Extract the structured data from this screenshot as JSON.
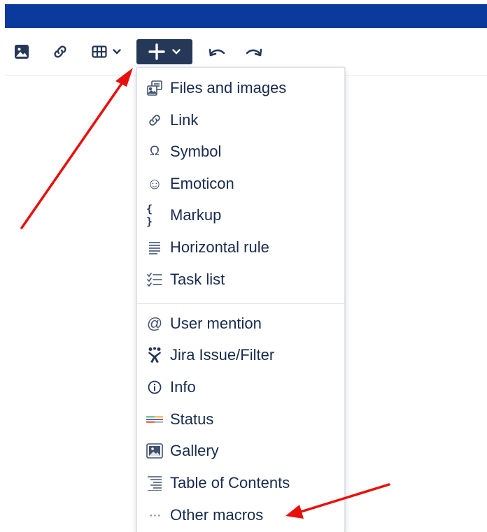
{
  "colors": {
    "topbar": "#0a3a9c",
    "toolbar_icon": "#253858",
    "arrow": "#e8100b",
    "insert_bg": "#253858"
  },
  "toolbar": {
    "buttons": [
      {
        "icon": "image-icon"
      },
      {
        "icon": "link-icon"
      },
      {
        "icon": "table-icon",
        "dropdown": true
      },
      {
        "icon": "plus-icon",
        "dropdown": true,
        "active": true
      },
      {
        "icon": "undo-icon"
      },
      {
        "icon": "redo-icon"
      }
    ]
  },
  "insert_menu": {
    "section1": [
      {
        "label": "Files and images",
        "icon": "files-images-icon"
      },
      {
        "label": "Link",
        "icon": "link-icon"
      },
      {
        "label": "Symbol",
        "icon": "omega-icon",
        "glyph": "Ω"
      },
      {
        "label": "Emoticon",
        "icon": "smiley-icon",
        "glyph": "☺"
      },
      {
        "label": "Markup",
        "icon": "braces-icon",
        "glyph": "{ }"
      },
      {
        "label": "Horizontal rule",
        "icon": "horizontal-rule-icon"
      },
      {
        "label": "Task list",
        "icon": "task-list-icon"
      }
    ],
    "section2": [
      {
        "label": "User mention",
        "icon": "at-icon",
        "glyph": "@"
      },
      {
        "label": "Jira Issue/Filter",
        "icon": "jira-icon"
      },
      {
        "label": "Info",
        "icon": "info-icon"
      },
      {
        "label": "Status",
        "icon": "status-icon"
      },
      {
        "label": "Gallery",
        "icon": "gallery-icon"
      },
      {
        "label": "Table of Contents",
        "icon": "table-of-contents-icon"
      },
      {
        "label": "Other macros",
        "icon": "more-icon",
        "glyph": "···"
      }
    ]
  }
}
